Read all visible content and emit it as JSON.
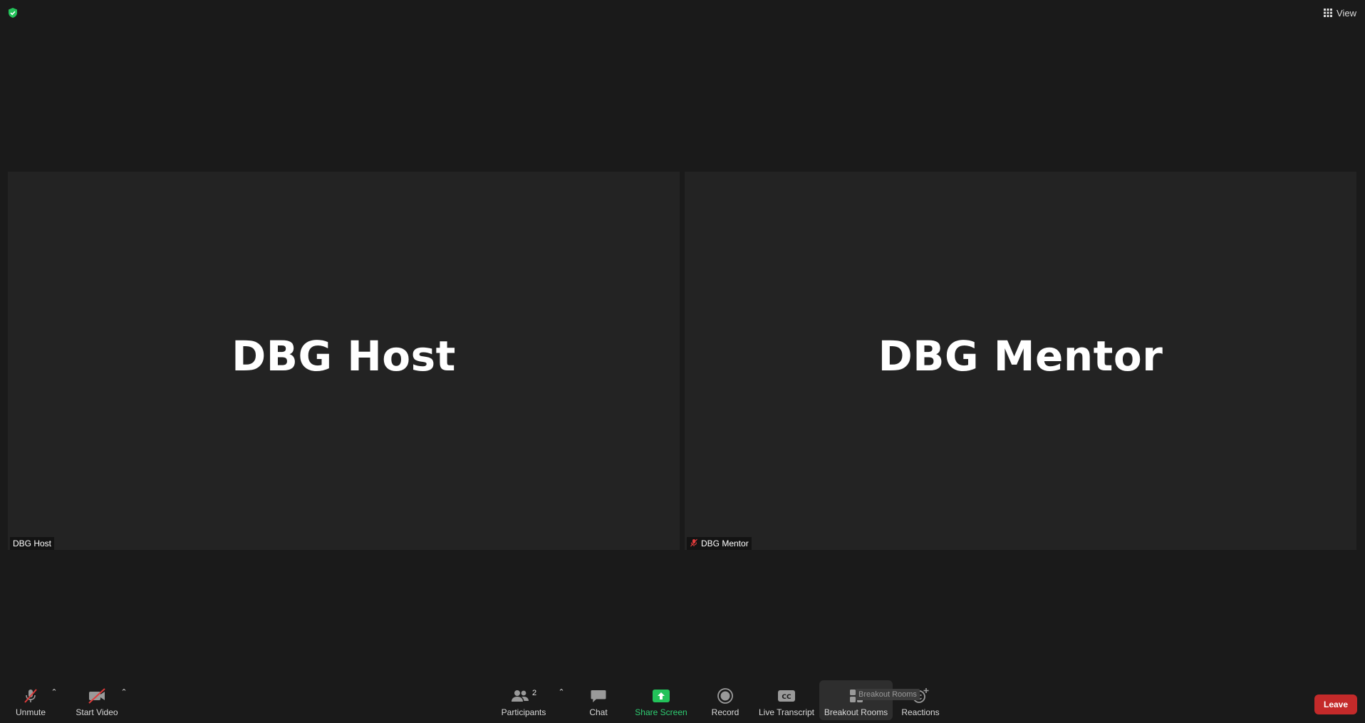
{
  "top_bar": {
    "security_icon": "shield-check-icon",
    "view_label": "View",
    "view_icon": "grid-icon"
  },
  "tiles": [
    {
      "display_name": "DBG Host",
      "label": "DBG Host",
      "muted": false
    },
    {
      "display_name": "DBG Mentor",
      "label": "DBG Mentor",
      "muted": true
    }
  ],
  "toolbar": {
    "unmute_label": "Unmute",
    "video_label": "Start Video",
    "participants_label": "Participants",
    "participants_count": "2",
    "chat_label": "Chat",
    "share_label": "Share Screen",
    "record_label": "Record",
    "transcript_label": "Live Transcript",
    "breakout_label": "Breakout Rooms",
    "reactions_label": "Reactions",
    "leave_label": "Leave",
    "tooltip_text": "Breakout Rooms"
  },
  "colors": {
    "background": "#1a1a1a",
    "tile": "#232323",
    "share_green": "#2ecc71",
    "leave_red": "#c42a2a",
    "muted_red": "#e03b3b"
  }
}
